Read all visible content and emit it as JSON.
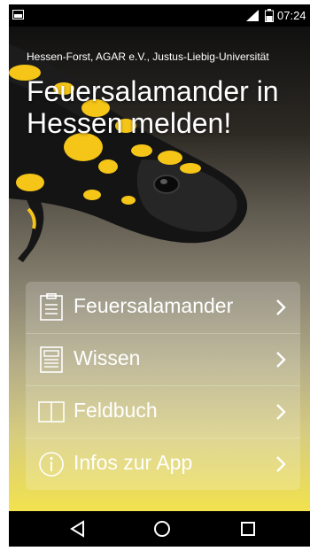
{
  "status_bar": {
    "time": "07:24",
    "icons": [
      "image-notification-icon",
      "signal-icon",
      "battery-icon"
    ]
  },
  "header": {
    "credit": "Hessen-Forst, AGAR e.V., Justus-Liebig-Universität",
    "title": "Feuersalamander in Hessen melden!"
  },
  "menu": {
    "items": [
      {
        "label": "Feuersalamander",
        "icon": "clipboard-icon"
      },
      {
        "label": "Wissen",
        "icon": "document-icon"
      },
      {
        "label": "Feldbuch",
        "icon": "book-icon"
      },
      {
        "label": "Infos zur App",
        "icon": "info-icon"
      }
    ]
  },
  "nav_bar": {
    "icons": [
      "back-icon",
      "home-icon",
      "recents-icon"
    ]
  },
  "colors": {
    "status_bar": "#000000",
    "gradient_top": "#101010",
    "gradient_bottom": "#f2e24e",
    "text": "#ffffff",
    "salamander_spots": "#f5c518"
  }
}
